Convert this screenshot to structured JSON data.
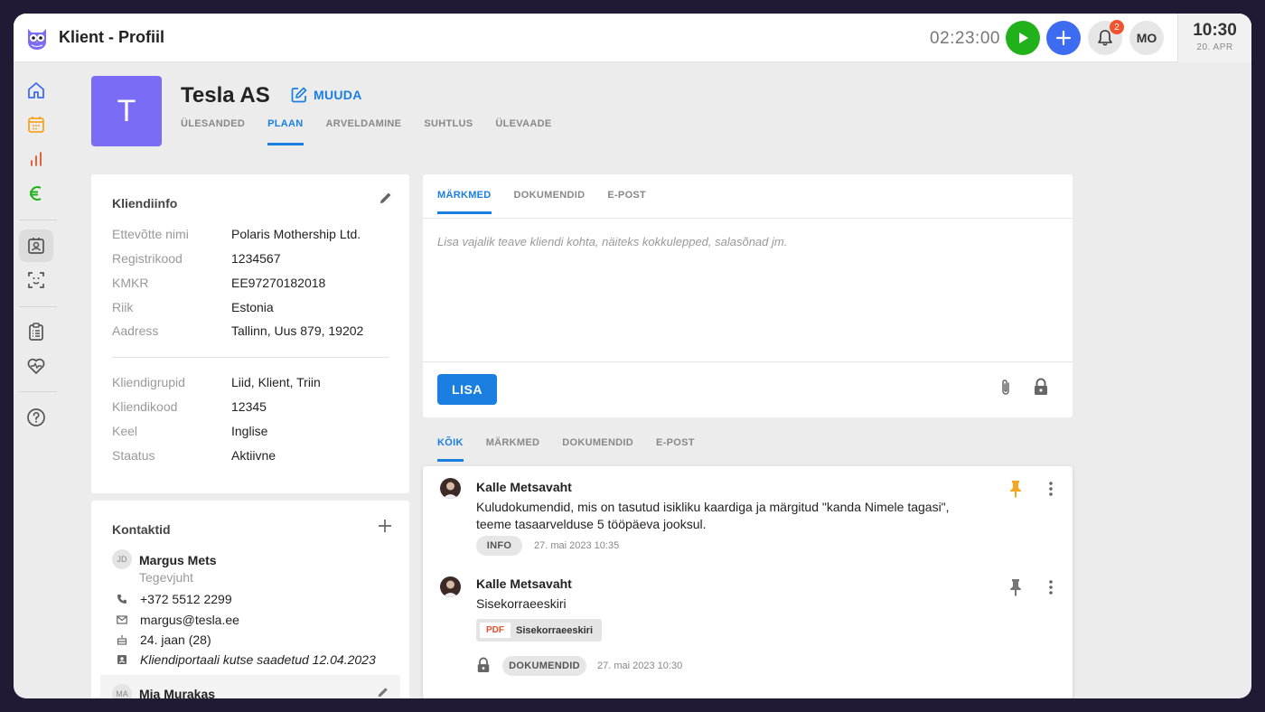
{
  "app": {
    "title": "Klient - Profiil",
    "timer": "02:23:00",
    "notifications": "2",
    "user_initials": "MO",
    "clock_time": "10:30",
    "clock_date": "20. APR"
  },
  "client": {
    "avatar_letter": "T",
    "name": "Tesla AS",
    "edit_label": "MUUDA",
    "tabs": [
      "ÜLESANDED",
      "PLAAN",
      "ARVELDAMINE",
      "SUHTLUS",
      "ÜLEVAADE"
    ],
    "active_tab": "PLAAN"
  },
  "info": {
    "title": "Kliendiinfo",
    "rows": [
      {
        "label": "Ettevõtte nimi",
        "value": "Polaris Mothership Ltd."
      },
      {
        "label": "Registrikood",
        "value": "1234567"
      },
      {
        "label": "KMKR",
        "value": "EE97270182018"
      },
      {
        "label": "Riik",
        "value": "Estonia"
      },
      {
        "label": "Aadress",
        "value": "Tallinn, Uus 879, 19202"
      },
      {
        "label": "Kliendigrupid",
        "value": "Liid, Klient, Triin"
      },
      {
        "label": "Kliendikood",
        "value": "12345"
      },
      {
        "label": "Keel",
        "value": "Inglise"
      },
      {
        "label": "Staatus",
        "value": "Aktiivne"
      }
    ]
  },
  "contacts": {
    "title": "Kontaktid",
    "items": [
      {
        "initials": "JD",
        "name": "Margus Mets",
        "role": "Tegevjuht",
        "phone": "+372 5512 2299",
        "email": "margus@tesla.ee",
        "birthday": "24. jaan (28)",
        "portal_note": "Kliendiportaali kutse saadetud 12.04.2023"
      },
      {
        "initials": "MA",
        "name": "Mia Murakas"
      }
    ]
  },
  "notes": {
    "tabs": [
      "MÄRKMED",
      "DOKUMENDID",
      "E-POST"
    ],
    "active_tab": "MÄRKMED",
    "placeholder": "Lisa vajalik teave kliendi kohta, näiteks kokkulepped, salasõnad jm.",
    "add_label": "LISA"
  },
  "feed": {
    "tabs": [
      "KÕIK",
      "MÄRKMED",
      "DOKUMENDID",
      "E-POST"
    ],
    "active_tab": "KÕIK",
    "items": [
      {
        "author": "Kalle Metsavaht",
        "text": "Kuludokumendid, mis on tasutud isikliku kaardiga ja märgitud \"kanda Nimele tagasi\", teeme tasaarvelduse 5 tööpäeva jooksul.",
        "tag": "INFO",
        "date": "27. mai 2023 10:35",
        "pinned": true
      },
      {
        "author": "Kalle Metsavaht",
        "text": "Sisekorraeeskiri",
        "attachment_type": "PDF",
        "attachment_name": "Sisekorraeeskiri",
        "tag": "DOKUMENDID",
        "date": "27. mai 2023 10:30",
        "pinned": false
      }
    ]
  },
  "colors": {
    "accent": "#1a7fe0",
    "avatar": "#7b6cf6",
    "play": "#21b11a",
    "add": "#3d6cf0",
    "pin_active": "#f5a623",
    "frame": "#221a35"
  }
}
